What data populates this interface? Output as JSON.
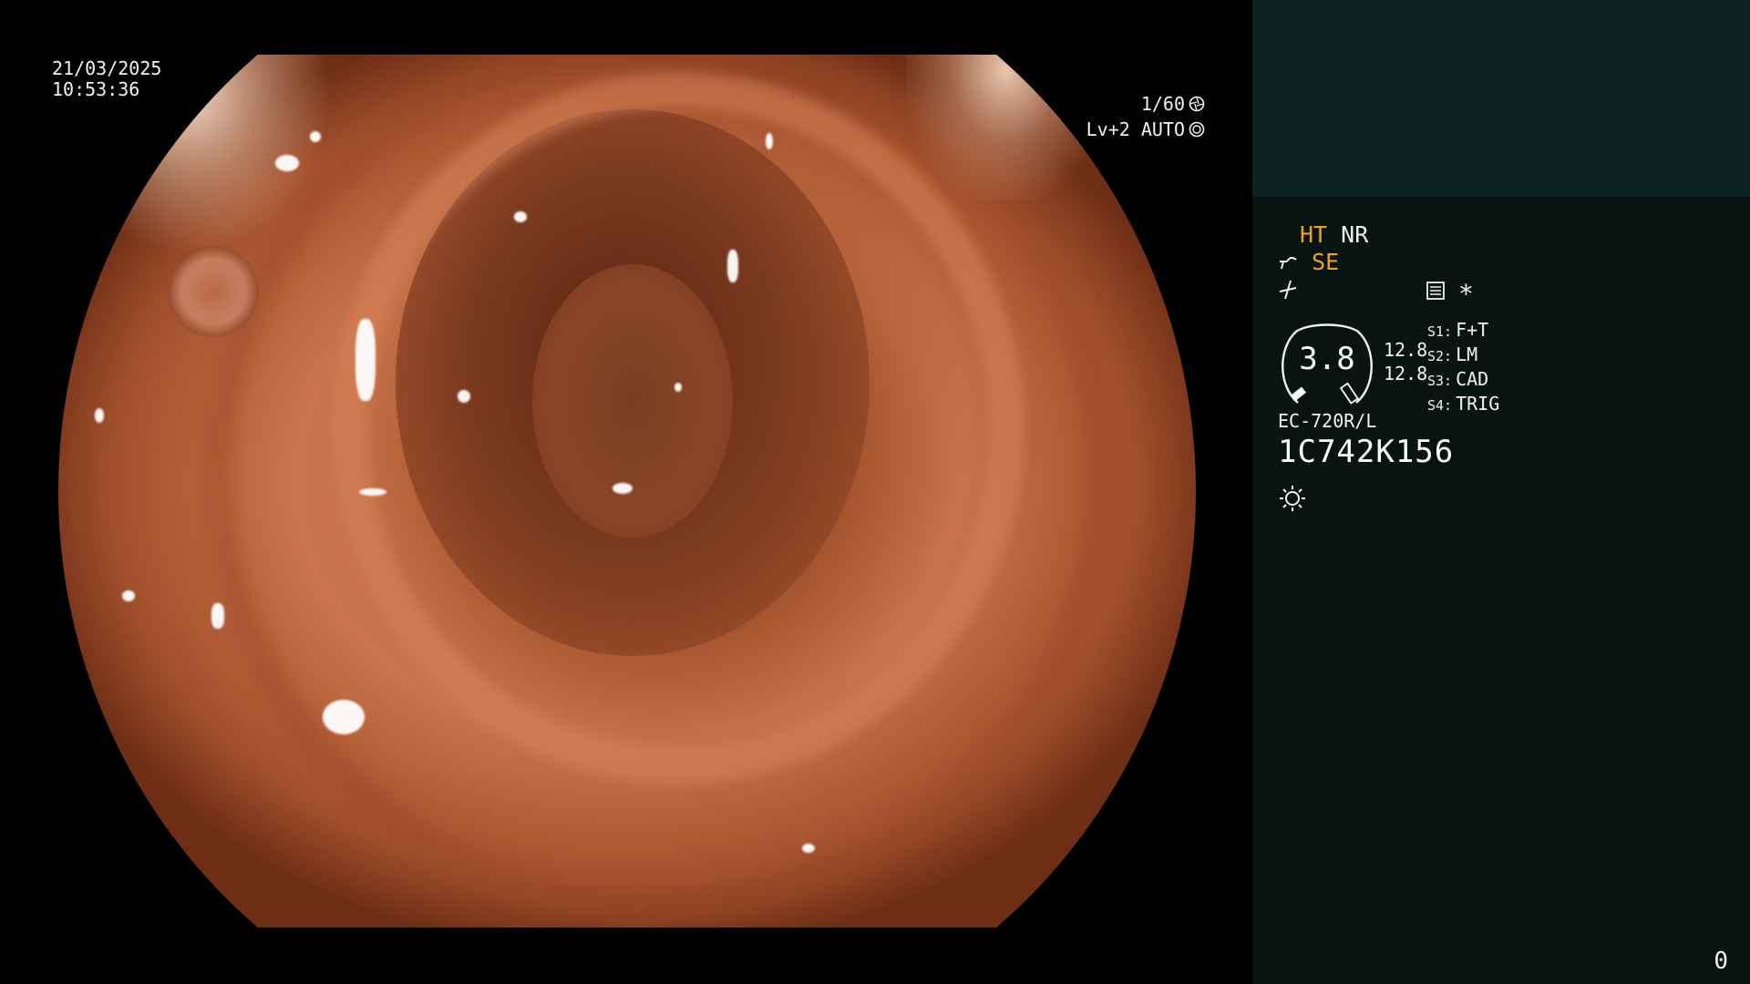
{
  "colors": {
    "panel_background": "#071411",
    "panel_header_background": "#0d2322",
    "mode_active": "#f0a21c",
    "text": "#f2f2f2"
  },
  "scope_view": {
    "date": "21/03/2025",
    "time": "10:53:36",
    "shutter": "1/60",
    "shutter_icon": "shutter-icon",
    "iris": "Lv+2 AUTO",
    "iris_icon": "iris-icon"
  },
  "info_panel": {
    "modes": {
      "ht": "HT",
      "nr": "NR",
      "se": "SE"
    },
    "icons": {
      "enhancement": "enhancement-icon",
      "tone_curve": "tone-curve-icon",
      "record": "record-icon",
      "asterisk": "asterisk-icon",
      "brightness": "brightness-icon"
    },
    "asterisk_label": "*",
    "meter_value": "3.8",
    "secondary_values": [
      "12.8",
      "12.8"
    ],
    "scope_switches": [
      {
        "key": "S1:",
        "label": "F+T"
      },
      {
        "key": "S2:",
        "label": "LM"
      },
      {
        "key": "S3:",
        "label": "CAD"
      },
      {
        "key": "S4:",
        "label": "TRIG"
      }
    ],
    "scope_model": "EC-720R/L",
    "scope_serial": "1C742K156",
    "counter": "0"
  }
}
